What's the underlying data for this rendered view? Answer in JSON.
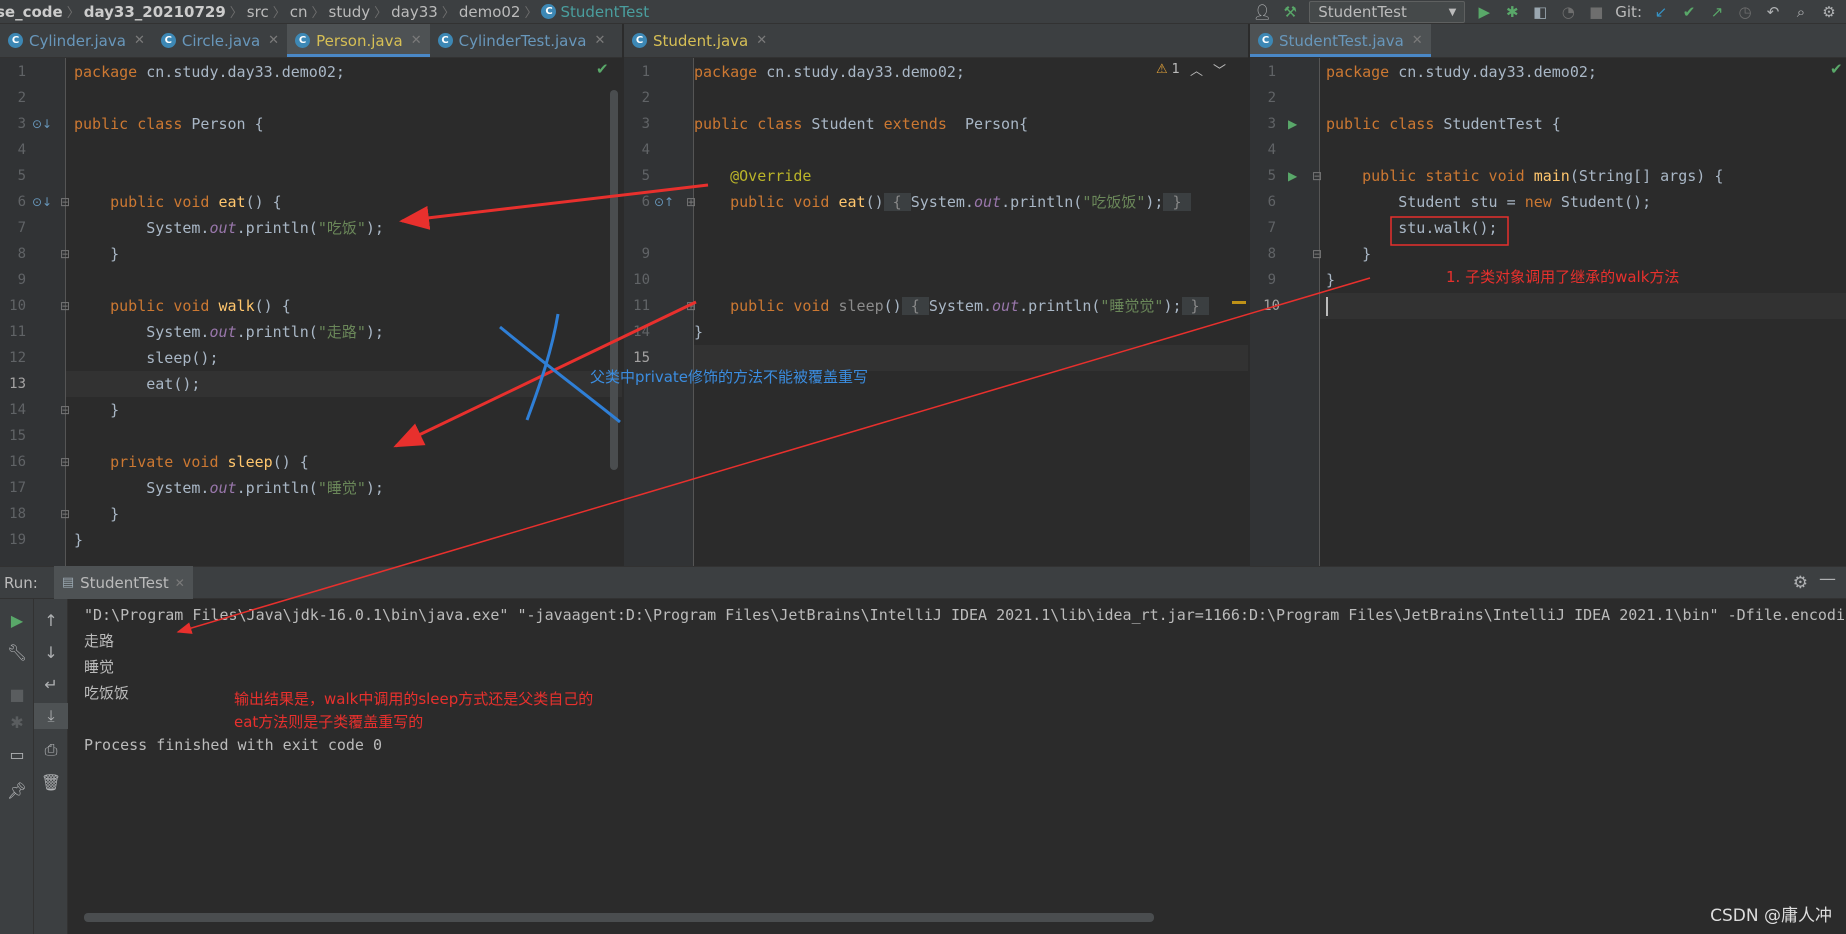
{
  "breadcrumbs": [
    "se_code",
    "day33_20210729",
    "src",
    "cn",
    "study",
    "day33",
    "demo02"
  ],
  "breadcrumb_class": "StudentTest",
  "toolbar": {
    "run_config": "StudentTest",
    "git_label": "Git:"
  },
  "left_tabs": [
    {
      "label": "Cylinder.java"
    },
    {
      "label": "Circle.java"
    },
    {
      "label": "Person.java"
    },
    {
      "label": "CylinderTest.java"
    }
  ],
  "middle_tabs": [
    {
      "label": "Student.java"
    }
  ],
  "right_tabs": [
    {
      "label": "StudentTest.java"
    }
  ],
  "editor_left": {
    "line_numbers": [
      "1",
      "2",
      "3",
      "4",
      "5",
      "6",
      "7",
      "8",
      "9",
      "10",
      "11",
      "12",
      "13",
      "14",
      "15",
      "16",
      "17",
      "18",
      "19"
    ]
  },
  "editor_middle": {
    "warning_count": "1",
    "line_numbers": [
      "1",
      "2",
      "3",
      "4",
      "5",
      "6",
      "9",
      "10",
      "11",
      "14",
      "15"
    ]
  },
  "editor_right": {
    "line_numbers": [
      "1",
      "2",
      "3",
      "4",
      "5",
      "6",
      "7",
      "8",
      "9",
      "10"
    ]
  },
  "run": {
    "label": "Run:",
    "tab": "StudentTest",
    "output": [
      "\"D:\\Program Files\\Java\\jdk-16.0.1\\bin\\java.exe\" \"-javaagent:D:\\Program Files\\JetBrains\\IntelliJ IDEA 2021.1\\lib\\idea_rt.jar=1166:D:\\Program Files\\JetBrains\\IntelliJ IDEA 2021.1\\bin\" -Dfile.encodin",
      "走路",
      "睡觉",
      "吃饭饭",
      "",
      "Process finished with exit code 0"
    ]
  },
  "annotations": {
    "private_note": "父类中private修饰的方法不能被覆盖重写",
    "walk_note": "1. 子类对象调用了继承的walk方法",
    "output_note_1": "输出结果是，walk中调用的sleep方式还是父类自己的",
    "output_note_2": "eat方法则是子类覆盖重写的"
  },
  "watermark": "CSDN @庸人冲",
  "colors": {
    "editor_bg": "#2b2b2b",
    "panel_bg": "#3c3f41",
    "keyword": "#cc7832",
    "function": "#ffc66d",
    "string": "#6a8759",
    "static_field": "#9876aa",
    "annotation": "#bbb529",
    "red_note": "#e8302d",
    "blue_note": "#3b8de0"
  }
}
